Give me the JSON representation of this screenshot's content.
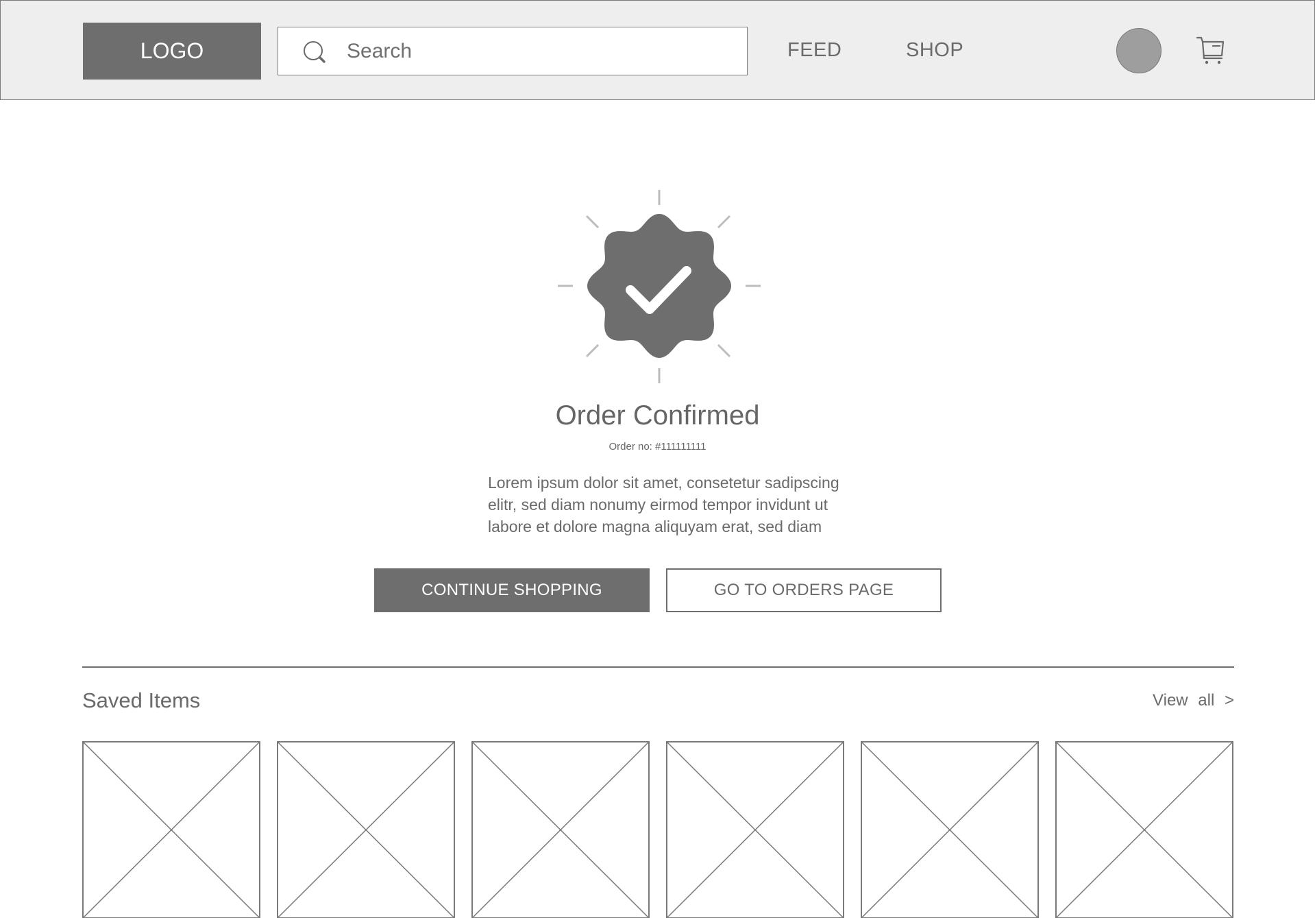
{
  "header": {
    "logo": "LOGO",
    "search_placeholder": "Search",
    "nav": {
      "feed": "FEED",
      "shop": "SHOP"
    },
    "icons": [
      "search-icon",
      "avatar",
      "cart-icon"
    ]
  },
  "confirmation": {
    "title": "Order Confirmed",
    "order_no": "Order no: #111111111",
    "description": "Lorem ipsum dolor sit amet, consetetur sadipscing elitr, sed diam nonumy eirmod tempor invidunt ut labore et dolore magna aliquyam erat, sed diam",
    "icon": "check-badge-icon",
    "buttons": {
      "continue": "CONTINUE SHOPPING",
      "orders": "GO TO ORDERS PAGE"
    }
  },
  "saved": {
    "title": "Saved Items",
    "view_all": "View all >",
    "items": [
      "image-placeholder",
      "image-placeholder",
      "image-placeholder",
      "image-placeholder",
      "image-placeholder",
      "image-placeholder"
    ]
  },
  "colors": {
    "header_bg": "#eeeeee",
    "primary": "#6e6e6e",
    "text": "#666666",
    "border": "#7a7a7a"
  }
}
